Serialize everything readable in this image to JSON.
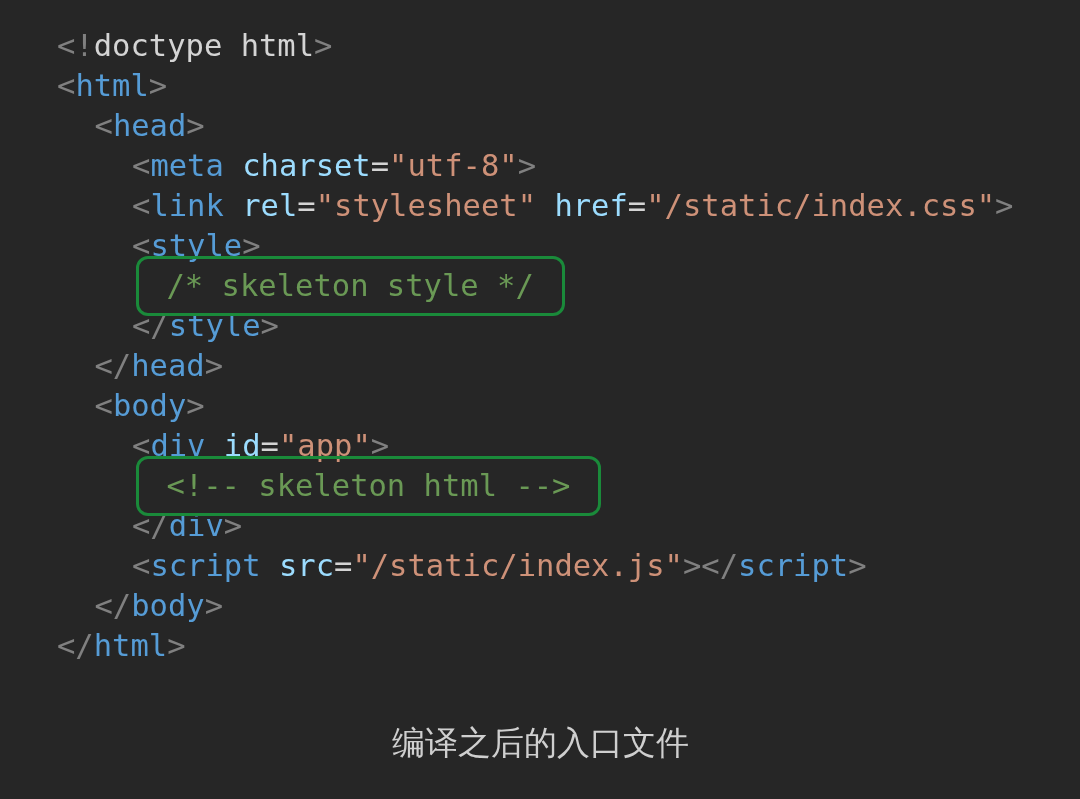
{
  "code": {
    "lines": [
      {
        "tokens": [
          {
            "kind": "punct",
            "text": "<!"
          },
          {
            "kind": "text",
            "text": "doctype html"
          },
          {
            "kind": "punct",
            "text": ">"
          }
        ]
      },
      {
        "tokens": [
          {
            "kind": "punct",
            "text": "<"
          },
          {
            "kind": "tag",
            "text": "html"
          },
          {
            "kind": "punct",
            "text": ">"
          }
        ],
        "children": [
          {
            "tokens": [
              {
                "kind": "punct",
                "text": "<"
              },
              {
                "kind": "tag",
                "text": "head"
              },
              {
                "kind": "punct",
                "text": ">"
              }
            ],
            "children": [
              {
                "tokens": [
                  {
                    "kind": "punct",
                    "text": "<"
                  },
                  {
                    "kind": "tag",
                    "text": "meta"
                  },
                  {
                    "kind": "attr",
                    "text": " charset"
                  },
                  {
                    "kind": "text",
                    "text": "="
                  },
                  {
                    "kind": "string",
                    "text": "\"utf-8\""
                  },
                  {
                    "kind": "punct",
                    "text": ">"
                  }
                ]
              },
              {
                "tokens": [
                  {
                    "kind": "punct",
                    "text": "<"
                  },
                  {
                    "kind": "tag",
                    "text": "link"
                  },
                  {
                    "kind": "attr",
                    "text": " rel"
                  },
                  {
                    "kind": "text",
                    "text": "="
                  },
                  {
                    "kind": "string",
                    "text": "\"stylesheet\""
                  },
                  {
                    "kind": "attr",
                    "text": " href"
                  },
                  {
                    "kind": "text",
                    "text": "="
                  },
                  {
                    "kind": "string",
                    "text": "\"/static/index.css\""
                  },
                  {
                    "kind": "punct",
                    "text": ">"
                  }
                ]
              },
              {
                "tokens": [
                  {
                    "kind": "punct",
                    "text": "<"
                  },
                  {
                    "kind": "tag",
                    "text": "style"
                  },
                  {
                    "kind": "punct",
                    "text": ">"
                  }
                ],
                "children": [
                  {
                    "highlighted": true,
                    "tokens": [
                      {
                        "kind": "comment",
                        "text": "/* skeleton style */"
                      }
                    ]
                  }
                ]
              },
              {
                "tokens": [
                  {
                    "kind": "punct",
                    "text": "</"
                  },
                  {
                    "kind": "tag",
                    "text": "style"
                  },
                  {
                    "kind": "punct",
                    "text": ">"
                  }
                ]
              }
            ]
          },
          {
            "tokens": [
              {
                "kind": "punct",
                "text": "</"
              },
              {
                "kind": "tag",
                "text": "head"
              },
              {
                "kind": "punct",
                "text": ">"
              }
            ]
          },
          {
            "tokens": [
              {
                "kind": "punct",
                "text": "<"
              },
              {
                "kind": "tag",
                "text": "body"
              },
              {
                "kind": "punct",
                "text": ">"
              }
            ],
            "children": [
              {
                "tokens": [
                  {
                    "kind": "punct",
                    "text": "<"
                  },
                  {
                    "kind": "tag",
                    "text": "div"
                  },
                  {
                    "kind": "attr",
                    "text": " id"
                  },
                  {
                    "kind": "text",
                    "text": "="
                  },
                  {
                    "kind": "string",
                    "text": "\"app\""
                  },
                  {
                    "kind": "punct",
                    "text": ">"
                  }
                ],
                "children": [
                  {
                    "highlighted": true,
                    "tokens": [
                      {
                        "kind": "comment",
                        "text": "<!-- skeleton html -->"
                      }
                    ]
                  }
                ]
              },
              {
                "tokens": [
                  {
                    "kind": "punct",
                    "text": "</"
                  },
                  {
                    "kind": "tag",
                    "text": "div"
                  },
                  {
                    "kind": "punct",
                    "text": ">"
                  }
                ]
              },
              {
                "tokens": [
                  {
                    "kind": "punct",
                    "text": "<"
                  },
                  {
                    "kind": "tag",
                    "text": "script"
                  },
                  {
                    "kind": "attr",
                    "text": " src"
                  },
                  {
                    "kind": "text",
                    "text": "="
                  },
                  {
                    "kind": "string",
                    "text": "\"/static/index.js\""
                  },
                  {
                    "kind": "punct",
                    "text": "></"
                  },
                  {
                    "kind": "tag",
                    "text": "script"
                  },
                  {
                    "kind": "punct",
                    "text": ">"
                  }
                ]
              }
            ]
          },
          {
            "tokens": [
              {
                "kind": "punct",
                "text": "</"
              },
              {
                "kind": "tag",
                "text": "body"
              },
              {
                "kind": "punct",
                "text": ">"
              }
            ]
          }
        ]
      },
      {
        "tokens": [
          {
            "kind": "punct",
            "text": "</"
          },
          {
            "kind": "tag",
            "text": "html"
          },
          {
            "kind": "punct",
            "text": ">"
          }
        ]
      }
    ]
  },
  "caption": "编译之后的入口文件"
}
